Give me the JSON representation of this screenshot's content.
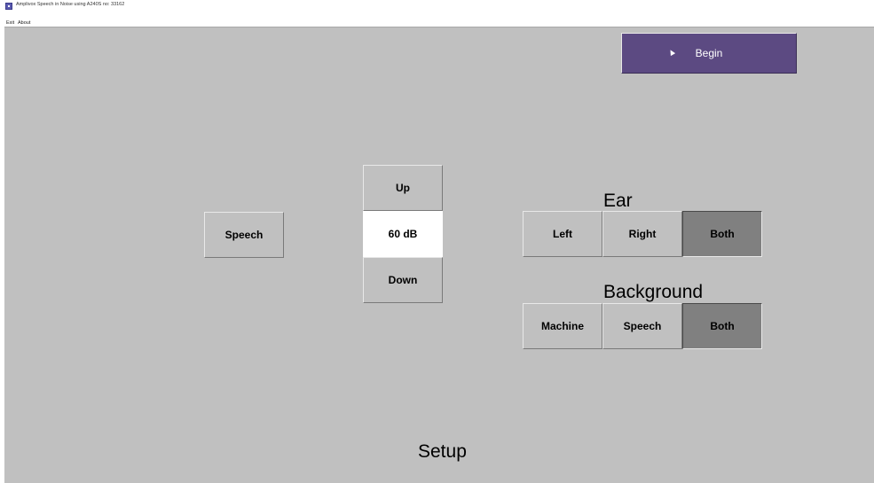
{
  "window": {
    "title": "Amplivox Speech in Noise using A240S no: 33162"
  },
  "menu": {
    "items": [
      "Exit",
      "About"
    ]
  },
  "begin_button": {
    "label": "Begin",
    "color": "#5c4a82"
  },
  "speech_button": {
    "label": "Speech"
  },
  "level": {
    "up_label": "Up",
    "value": "60 dB",
    "down_label": "Down"
  },
  "ear": {
    "heading": "Ear",
    "options": [
      "Left",
      "Right",
      "Both"
    ],
    "selected": "Both"
  },
  "background": {
    "heading": "Background",
    "options": [
      "Machine",
      "Speech",
      "Both"
    ],
    "selected": "Both"
  },
  "footer": {
    "title": "Setup"
  },
  "icons": {
    "app": "app-icon",
    "cursor": "mouse-pointer-icon"
  }
}
